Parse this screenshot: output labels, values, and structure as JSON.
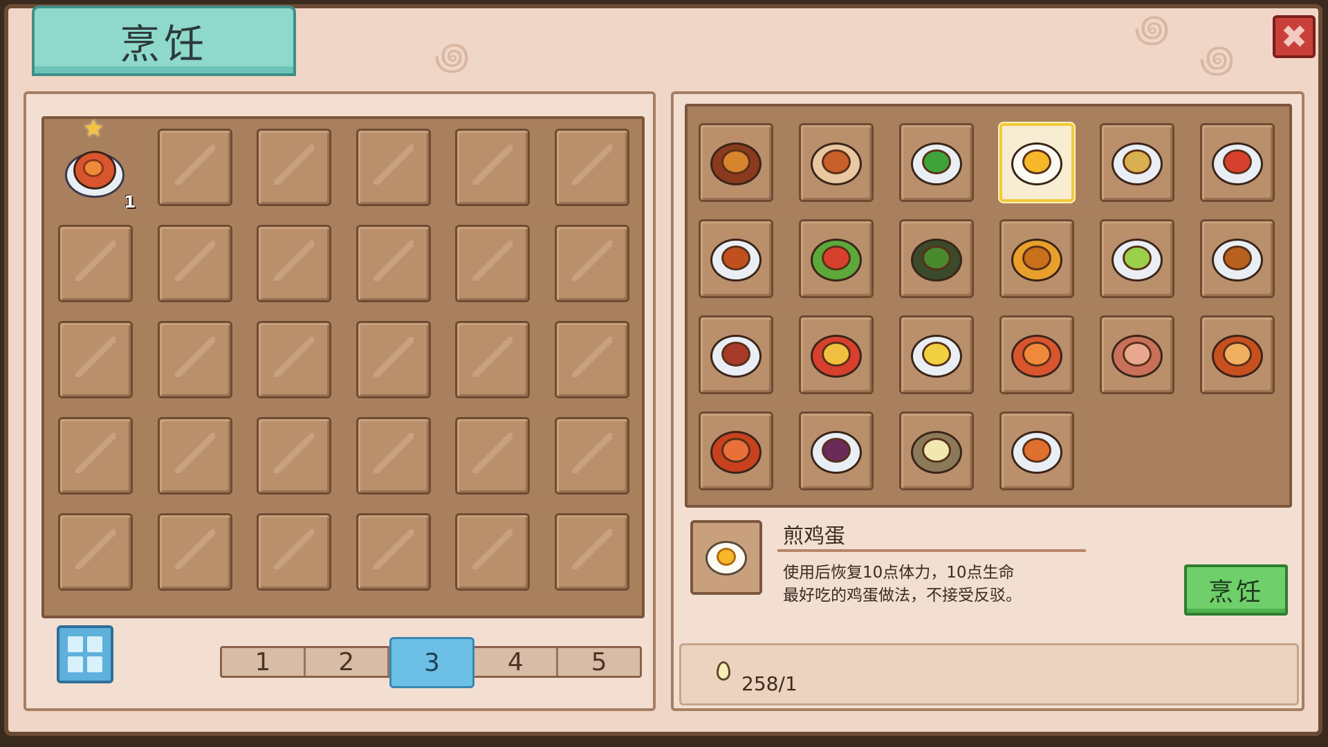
{
  "window": {
    "title": "烹饪",
    "close_label": "✖"
  },
  "inventory": {
    "slots": [
      {
        "item": "fried-fish-dish",
        "qty": "1",
        "starred": true
      }
    ],
    "pages": [
      "1",
      "2",
      "3",
      "4",
      "5"
    ],
    "active_page": "3"
  },
  "recipes": [
    "meat-lasagna-icon",
    "soup-bowl-icon",
    "green-salad-icon",
    "fried-egg-icon",
    "dumplings-icon",
    "tomato-dish-icon",
    "stew-bowl-icon",
    "vegetable-soup-icon",
    "pickle-jar-icon",
    "fried-chicken-icon",
    "mixed-salad-icon",
    "noodle-bowl-icon",
    "roast-meat-icon",
    "curry-bowl-icon",
    "corn-plate-icon",
    "fried-fish-icon",
    "steak-icon",
    "pie-slice-icon",
    "pizza-icon",
    "berry-plate-icon",
    "porridge-icon",
    "shrimp-plate-icon"
  ],
  "selected_recipe": {
    "name": "煎鸡蛋",
    "desc_line1": "使用后恢复10点体力，10点生命",
    "desc_line2": "最好吃的鸡蛋做法，不接受反驳。"
  },
  "cook_button": {
    "label": "烹饪"
  },
  "ingredient": {
    "icon": "egg-icon",
    "count": "258/1"
  }
}
